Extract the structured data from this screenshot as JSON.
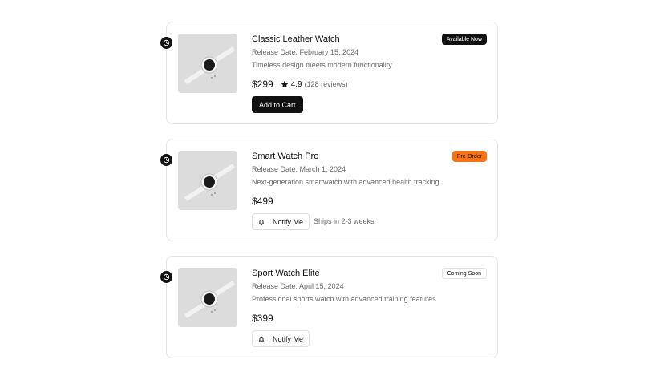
{
  "colors": {
    "accent": "#111111",
    "preorder": "#f97316",
    "muted": "#6b6b6b",
    "border": "#e4e4e7"
  },
  "products": [
    {
      "title": "Classic Leather Watch",
      "release": "Release Date: February 15, 2024",
      "description": "Timeless design meets modern functionality",
      "price": "$299",
      "rating": "4.9",
      "reviews": "(128 reviews)",
      "badge": "Available Now",
      "button": "Add to Cart",
      "icon": "clock-icon"
    },
    {
      "title": "Smart Watch Pro",
      "release": "Release Date: March 1, 2024",
      "description": "Next-generation smartwatch with advanced health tracking",
      "price": "$499",
      "badge": "Pre-Order",
      "button": "Notify Me",
      "shipping": "Ships in 2-3 weeks",
      "icon": "clock-icon"
    },
    {
      "title": "Sport Watch Elite",
      "release": "Release Date: April 15, 2024",
      "description": "Professional sports watch with advanced training features",
      "price": "$399",
      "badge": "Coming Soon",
      "button": "Notify Me",
      "icon": "clock-icon"
    }
  ]
}
